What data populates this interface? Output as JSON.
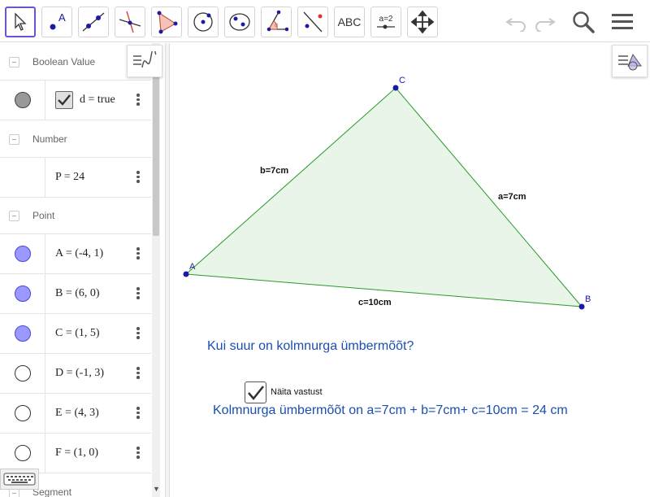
{
  "toolbar": {
    "tools": [
      {
        "name": "move-tool",
        "icon": "cursor-arrow-icon"
      },
      {
        "name": "point-tool",
        "icon": "point-a-icon"
      },
      {
        "name": "line-tool",
        "icon": "line-through-points-icon"
      },
      {
        "name": "perpendicular-tool",
        "icon": "perpendicular-line-icon"
      },
      {
        "name": "polygon-tool",
        "icon": "triangle-polygon-icon"
      },
      {
        "name": "circle-tool",
        "icon": "circle-center-point-icon"
      },
      {
        "name": "ellipse-tool",
        "icon": "conic-icon"
      },
      {
        "name": "angle-tool",
        "icon": "angle-icon"
      },
      {
        "name": "reflect-tool",
        "icon": "reflect-point-icon"
      },
      {
        "name": "text-tool",
        "label": "ABC"
      },
      {
        "name": "slider-tool",
        "label": "a=2"
      },
      {
        "name": "move-graphics-tool",
        "icon": "four-arrows-icon"
      }
    ],
    "undo_icon": "undo-icon",
    "redo_icon": "redo-icon",
    "search_icon": "search-icon",
    "menu_icon": "hamburger-menu-icon"
  },
  "algebra": {
    "groups": [
      {
        "label": "Boolean Value"
      },
      {
        "label": "Number"
      },
      {
        "label": "Point"
      },
      {
        "label": "Segment"
      }
    ],
    "boolean": {
      "formula": "d = true",
      "checked": true
    },
    "number": {
      "formula": "P = 24"
    },
    "points": [
      {
        "formula": "A = (-4, 1)",
        "visible": true
      },
      {
        "formula": "B = (6, 0)",
        "visible": true
      },
      {
        "formula": "C = (1, 5)",
        "visible": true
      },
      {
        "formula": "D = (-1, 3)",
        "visible": false
      },
      {
        "formula": "E = (4, 3)",
        "visible": false
      },
      {
        "formula": "F = (1, 0)",
        "visible": false
      }
    ]
  },
  "graphics": {
    "points": [
      {
        "label": "A"
      },
      {
        "label": "B"
      },
      {
        "label": "C"
      }
    ],
    "segment_labels": {
      "a": "a=7cm",
      "b": "b=7cm",
      "c": "c=10cm"
    },
    "question": "Kui suur on kolmnurga ümbermõõt?",
    "checkbox_label": "Näita vastust",
    "checkbox_checked": true,
    "answer": "Kolmnurga ümbermõõt on a=7cm + b=7cm+ c=10cm = 24 cm",
    "colors": {
      "triangle_fill": "#e6f4e6",
      "triangle_stroke": "#2a9a2a",
      "point": "#1a1aa6",
      "text_blue": "#1a4fb0"
    }
  }
}
